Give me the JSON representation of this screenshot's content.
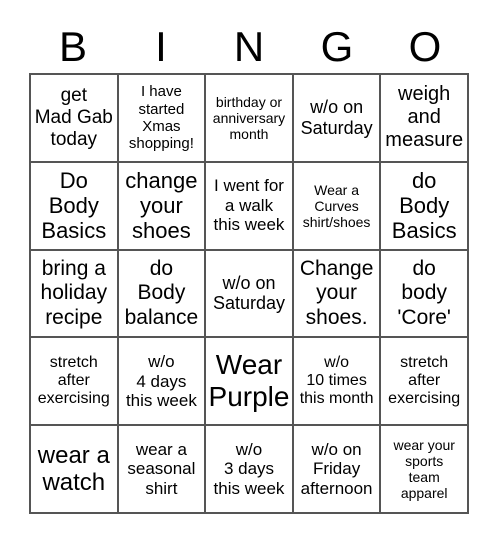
{
  "header": {
    "letters": [
      "B",
      "I",
      "N",
      "G",
      "O"
    ]
  },
  "cells": [
    {
      "text": "get\nMad Gab\ntoday",
      "size": 19
    },
    {
      "text": "I have\nstarted\nXmas\nshopping!",
      "size": 15
    },
    {
      "text": "birthday or\nanniversary\nmonth",
      "size": 14
    },
    {
      "text": "w/o on\nSaturday",
      "size": 18
    },
    {
      "text": "weigh\nand\nmeasure",
      "size": 20
    },
    {
      "text": "Do\nBody\nBasics",
      "size": 22
    },
    {
      "text": "change\nyour\nshoes",
      "size": 22
    },
    {
      "text": "I went for\na walk\nthis week",
      "size": 17
    },
    {
      "text": "Wear a\nCurves\nshirt/shoes",
      "size": 14
    },
    {
      "text": "do\nBody\nBasics",
      "size": 22
    },
    {
      "text": "bring a\nholiday\nrecipe",
      "size": 21
    },
    {
      "text": "do\nBody\nbalance",
      "size": 21
    },
    {
      "text": "w/o on\nSaturday",
      "size": 18
    },
    {
      "text": "Change\nyour\nshoes.",
      "size": 21
    },
    {
      "text": "do\nbody\n'Core'",
      "size": 21
    },
    {
      "text": "stretch\nafter\nexercising",
      "size": 16
    },
    {
      "text": "w/o\n4 days\nthis week",
      "size": 17
    },
    {
      "text": "Wear\nPurple",
      "size": 28
    },
    {
      "text": "w/o\n10 times\nthis month",
      "size": 16
    },
    {
      "text": "stretch\nafter\nexercising",
      "size": 16
    },
    {
      "text": "wear a\nwatch",
      "size": 24
    },
    {
      "text": "wear a\nseasonal\nshirt",
      "size": 17
    },
    {
      "text": "w/o\n3 days\nthis week",
      "size": 17
    },
    {
      "text": "w/o on\nFriday\nafternoon",
      "size": 17
    },
    {
      "text": "wear your\nsports\nteam\napparel",
      "size": 14
    }
  ]
}
